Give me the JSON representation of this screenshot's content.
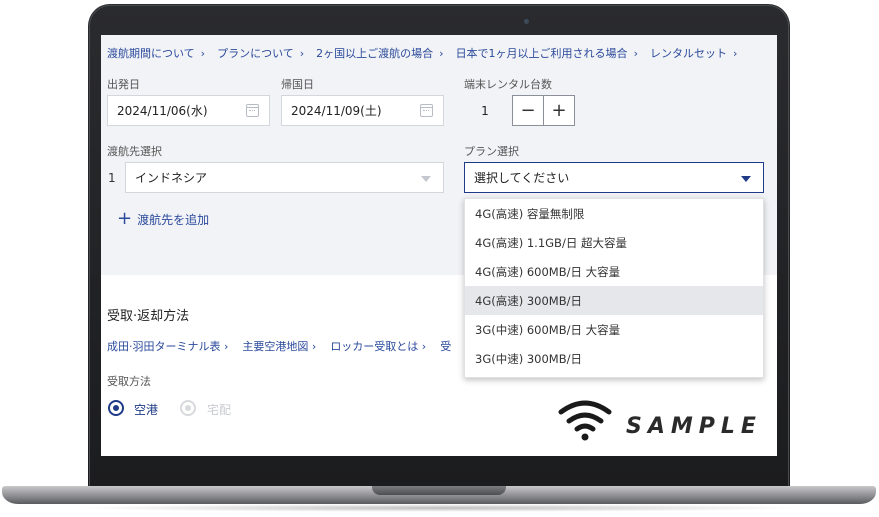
{
  "breadcrumbs": [
    "渡航期間について",
    "プランについて",
    "2ヶ国以上ご渡航の場合",
    "日本で1ヶ月以上ご利用される場合",
    "レンタルセット"
  ],
  "departure": {
    "label": "出発日",
    "value": "2024/11/06(水)"
  },
  "return": {
    "label": "帰国日",
    "value": "2024/11/09(土)"
  },
  "rental_count": {
    "label": "端末レンタル台数",
    "value": "1",
    "minus": "−",
    "plus": "+"
  },
  "destination": {
    "label": "渡航先選択",
    "index": "1",
    "value": "インドネシア",
    "add_label": "渡航先を追加"
  },
  "plan": {
    "label": "プラン選択",
    "placeholder": "選択してください",
    "options": [
      "4G(高速) 容量無制限",
      "4G(高速) 1.1GB/日 超大容量",
      "4G(高速) 600MB/日 大容量",
      "4G(高速) 300MB/日",
      "3G(中速) 600MB/日 大容量",
      "3G(中速) 300MB/日"
    ],
    "highlighted_index": 3
  },
  "pickup": {
    "title": "受取·返却方法",
    "links": [
      "成田·羽田ターミナル表",
      "主要空港地図",
      "ロッカー受取とは",
      "受"
    ],
    "method_label": "受取方法",
    "options": [
      {
        "label": "空港",
        "selected": true
      },
      {
        "label": "宅配",
        "selected": false
      }
    ]
  },
  "watermark": {
    "text": "SAMPLE",
    "icon": "wifi-icon"
  },
  "colors": {
    "accent": "#1f3b87",
    "link": "#2b4a9c",
    "panel_bg": "#f2f3f6",
    "highlight": "#e6e7ea"
  }
}
